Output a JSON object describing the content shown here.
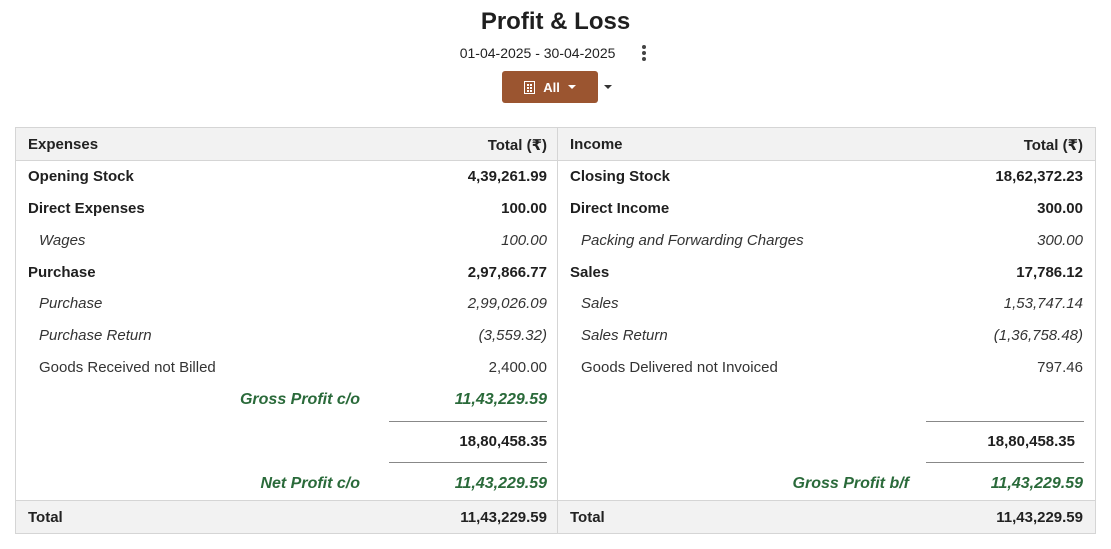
{
  "title": "Profit & Loss",
  "date_range": "01-04-2025 - 30-04-2025",
  "branch": {
    "label": "All"
  },
  "expenses": {
    "header": "Expenses",
    "total_header": "Total (₹)",
    "rows": [
      {
        "label": "Opening Stock",
        "amount": "4,39,261.99"
      },
      {
        "label": "Direct Expenses",
        "amount": "100.00"
      },
      {
        "label": "Wages",
        "amount": "100.00"
      },
      {
        "label": "Purchase",
        "amount": "2,97,866.77"
      },
      {
        "label": "Purchase",
        "amount": "2,99,026.09"
      },
      {
        "label": "Purchase Return",
        "amount": "(3,559.32)"
      },
      {
        "label": "Goods Received not Billed",
        "amount": "2,400.00"
      }
    ],
    "gross_profit_label": "Gross Profit c/o",
    "gross_profit_amount": "11,43,229.59",
    "subtotal": "18,80,458.35",
    "net_profit_label": "Net Profit c/o",
    "net_profit_amount": "11,43,229.59",
    "total_label": "Total",
    "total_amount": "11,43,229.59"
  },
  "income": {
    "header": "Income",
    "total_header": "Total (₹)",
    "rows": [
      {
        "label": "Closing Stock",
        "amount": "18,62,372.23"
      },
      {
        "label": "Direct Income",
        "amount": "300.00"
      },
      {
        "label": "Packing and Forwarding Charges",
        "amount": "300.00"
      },
      {
        "label": "Sales",
        "amount": "17,786.12"
      },
      {
        "label": "Sales",
        "amount": "1,53,747.14"
      },
      {
        "label": "Sales Return",
        "amount": "(1,36,758.48)"
      },
      {
        "label": "Goods Delivered not Invoiced",
        "amount": "797.46"
      }
    ],
    "subtotal": "18,80,458.35",
    "gross_profit_label": "Gross Profit b/f",
    "gross_profit_amount": "11,43,229.59",
    "total_label": "Total",
    "total_amount": "11,43,229.59"
  },
  "colors": {
    "accent": "#9b5530",
    "profit": "#2a6a3a"
  },
  "icons": [
    "building-icon",
    "caret-down-icon",
    "kebab-menu-icon"
  ]
}
